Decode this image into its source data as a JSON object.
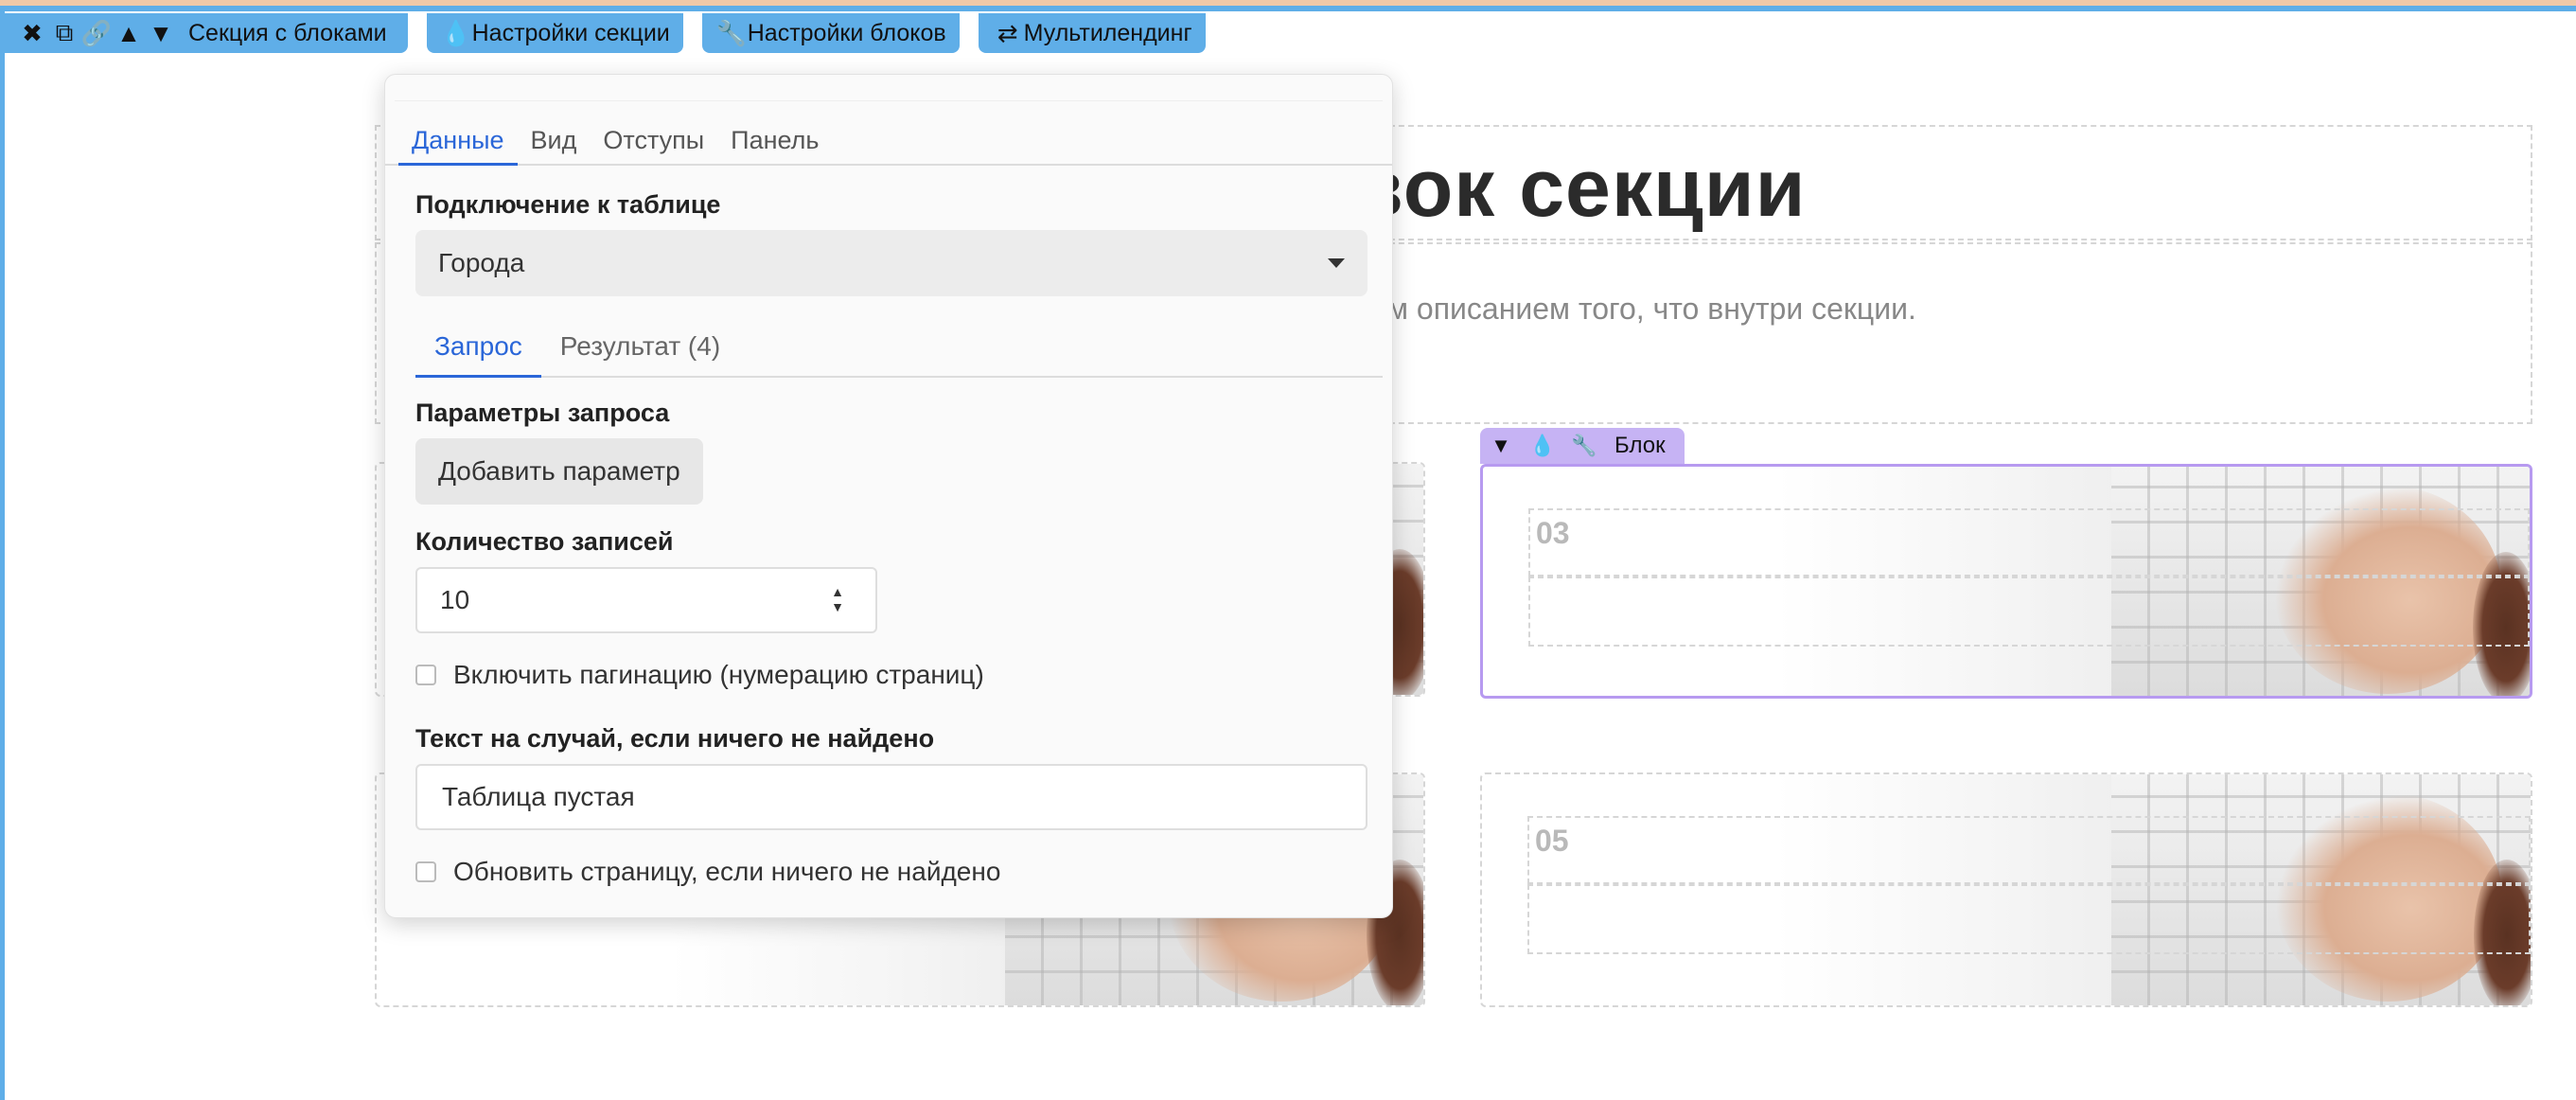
{
  "toolbar": {
    "section_label": "Секция с блоками",
    "section_settings": "Настройки секции",
    "block_settings": "Настройки блоков",
    "multilanding": "Мультилендинг",
    "icons": [
      "close-icon",
      "copy-icon",
      "link-icon",
      "chevron-up-icon",
      "chevron-down-icon"
    ]
  },
  "page": {
    "title_fragment": "вок секции",
    "description_fragment": "м описанием того, что внутри секции."
  },
  "cards": {
    "card3_number": "03",
    "card5_number": "05"
  },
  "block_toolbar": {
    "label": "Блок"
  },
  "popup": {
    "tabs": [
      "Данные",
      "Вид",
      "Отступы",
      "Панель"
    ],
    "table_label": "Подключение к таблице",
    "table_value": "Города",
    "subtabs": [
      "Запрос",
      "Результат (4)"
    ],
    "query_params_label": "Параметры запроса",
    "add_param_button": "Добавить параметр",
    "records_label": "Количество записей",
    "records_value": "10",
    "pagination_label": "Включить пагинацию (нумерацию страниц)",
    "empty_text_label": "Текст на случай, если ничего не найдено",
    "empty_text_value": "Таблица пустая",
    "refresh_label": "Обновить страницу, если ничего не найдено"
  },
  "colors": {
    "section_toolbar": "#5faee8",
    "block_toolbar": "#c6b3f4",
    "active_tab": "#2a66d8"
  }
}
